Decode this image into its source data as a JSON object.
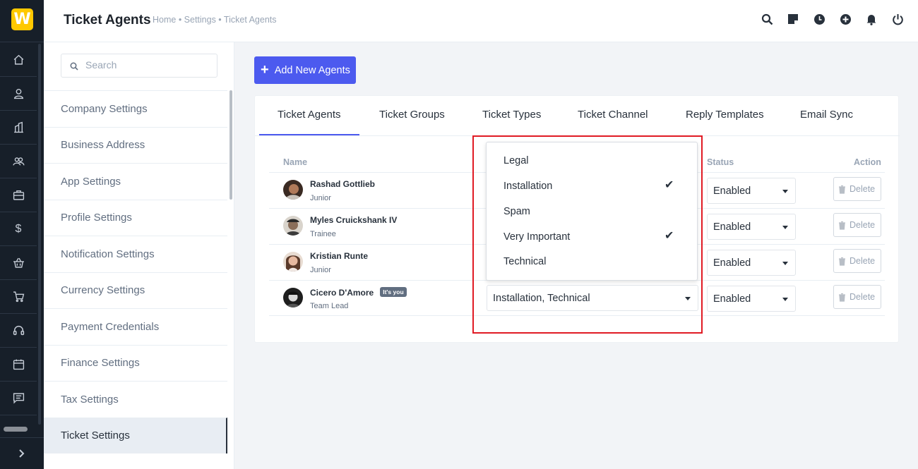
{
  "app": {
    "logo_letter": "W",
    "logo_color": "#ffc800",
    "accent_color": "#4c5aef",
    "highlight_color": "#e01b24"
  },
  "rail": {
    "icons": [
      "home-icon",
      "user-icon",
      "building-icon",
      "users-icon",
      "briefcase-icon",
      "dollar-icon",
      "basket-icon",
      "cart-icon",
      "headset-icon",
      "calendar-icon",
      "message-icon"
    ],
    "dollar_glyph": "$",
    "expand_icon": "chevron-right-icon"
  },
  "header": {
    "title": "Ticket Agents",
    "breadcrumb": "Home • Settings • Ticket Agents",
    "icons": [
      "search-icon",
      "sticky-note-icon",
      "clock-icon",
      "plus-circle-icon",
      "bell-icon",
      "power-icon"
    ]
  },
  "settings_sidebar": {
    "search_placeholder": "Search",
    "items": [
      {
        "label": "Company Settings"
      },
      {
        "label": "Business Address"
      },
      {
        "label": "App Settings"
      },
      {
        "label": "Profile Settings"
      },
      {
        "label": "Notification Settings"
      },
      {
        "label": "Currency Settings"
      },
      {
        "label": "Payment Credentials"
      },
      {
        "label": "Finance Settings"
      },
      {
        "label": "Tax Settings"
      },
      {
        "label": "Ticket Settings",
        "active": true
      }
    ]
  },
  "toolbar": {
    "add_button_label": "Add New Agents",
    "add_button_glyph": "+"
  },
  "tabs": [
    {
      "label": "Ticket Agents",
      "active": true
    },
    {
      "label": "Ticket Groups"
    },
    {
      "label": "Ticket Types"
    },
    {
      "label": "Ticket Channel"
    },
    {
      "label": "Reply Templates"
    },
    {
      "label": "Email Sync"
    }
  ],
  "table": {
    "columns": {
      "name": "Name",
      "status": "Status",
      "action": "Action"
    },
    "rows": [
      {
        "name": "Rashad Gottlieb",
        "role": "Junior",
        "status": "Enabled",
        "delete_label": "Delete"
      },
      {
        "name": "Myles Cruickshank IV",
        "role": "Trainee",
        "status": "Enabled",
        "delete_label": "Delete"
      },
      {
        "name": "Kristian Runte",
        "role": "Junior",
        "status": "Enabled",
        "delete_label": "Delete"
      },
      {
        "name": "Cicero D'Amore",
        "badge": "It's you",
        "role": "Team Lead",
        "groups": "Installation, Technical",
        "status": "Enabled",
        "delete_label": "Delete"
      }
    ]
  },
  "dropdown": {
    "check_glyph": "✔",
    "options": [
      {
        "label": "Legal",
        "checked": false
      },
      {
        "label": "Installation",
        "checked": true
      },
      {
        "label": "Spam",
        "checked": false
      },
      {
        "label": "Very Important",
        "checked": true
      },
      {
        "label": "Technical",
        "checked": false
      }
    ]
  }
}
